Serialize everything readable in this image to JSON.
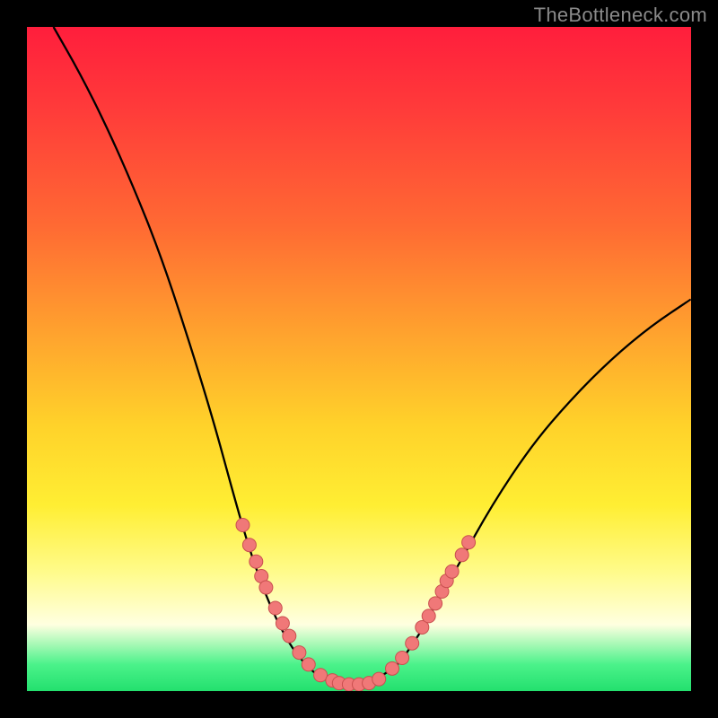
{
  "watermark": "TheBottleneck.com",
  "colors": {
    "frame": "#000000",
    "curve": "#000000",
    "marker_fill": "#f07878",
    "marker_stroke": "#c94f4f"
  },
  "chart_data": {
    "type": "line",
    "title": "",
    "xlabel": "",
    "ylabel": "",
    "xlim": [
      0,
      100
    ],
    "ylim": [
      0,
      100
    ],
    "curve": [
      {
        "x": 4,
        "y": 100
      },
      {
        "x": 8,
        "y": 93
      },
      {
        "x": 12,
        "y": 85
      },
      {
        "x": 16,
        "y": 76
      },
      {
        "x": 20,
        "y": 66
      },
      {
        "x": 24,
        "y": 54
      },
      {
        "x": 28,
        "y": 41
      },
      {
        "x": 31,
        "y": 30
      },
      {
        "x": 33,
        "y": 23
      },
      {
        "x": 35,
        "y": 17
      },
      {
        "x": 37,
        "y": 12
      },
      {
        "x": 39,
        "y": 8
      },
      {
        "x": 41,
        "y": 5
      },
      {
        "x": 44,
        "y": 2
      },
      {
        "x": 47,
        "y": 1
      },
      {
        "x": 50,
        "y": 1
      },
      {
        "x": 53,
        "y": 2
      },
      {
        "x": 56,
        "y": 4
      },
      {
        "x": 58,
        "y": 7
      },
      {
        "x": 60,
        "y": 10
      },
      {
        "x": 62,
        "y": 14
      },
      {
        "x": 65,
        "y": 19
      },
      {
        "x": 70,
        "y": 28
      },
      {
        "x": 76,
        "y": 37
      },
      {
        "x": 82,
        "y": 44
      },
      {
        "x": 88,
        "y": 50
      },
      {
        "x": 94,
        "y": 55
      },
      {
        "x": 100,
        "y": 59
      }
    ],
    "markers_left": [
      {
        "x": 32.5,
        "y": 25
      },
      {
        "x": 33.5,
        "y": 22
      },
      {
        "x": 34.5,
        "y": 19.5
      },
      {
        "x": 35.3,
        "y": 17.3
      },
      {
        "x": 36.0,
        "y": 15.6
      },
      {
        "x": 37.4,
        "y": 12.5
      },
      {
        "x": 38.5,
        "y": 10.2
      },
      {
        "x": 39.5,
        "y": 8.3
      },
      {
        "x": 41.0,
        "y": 5.8
      },
      {
        "x": 42.4,
        "y": 4.0
      },
      {
        "x": 44.2,
        "y": 2.4
      },
      {
        "x": 46.0,
        "y": 1.6
      }
    ],
    "markers_bottom": [
      {
        "x": 47.0,
        "y": 1.2
      },
      {
        "x": 48.5,
        "y": 1.0
      },
      {
        "x": 50.0,
        "y": 1.0
      },
      {
        "x": 51.5,
        "y": 1.2
      },
      {
        "x": 53.0,
        "y": 1.8
      }
    ],
    "markers_right": [
      {
        "x": 55.0,
        "y": 3.4
      },
      {
        "x": 56.5,
        "y": 5.0
      },
      {
        "x": 58.0,
        "y": 7.2
      },
      {
        "x": 59.5,
        "y": 9.6
      },
      {
        "x": 60.5,
        "y": 11.3
      },
      {
        "x": 61.5,
        "y": 13.2
      },
      {
        "x": 62.5,
        "y": 15.0
      },
      {
        "x": 63.2,
        "y": 16.6
      },
      {
        "x": 64.0,
        "y": 18.0
      },
      {
        "x": 65.5,
        "y": 20.5
      },
      {
        "x": 66.5,
        "y": 22.4
      }
    ]
  }
}
